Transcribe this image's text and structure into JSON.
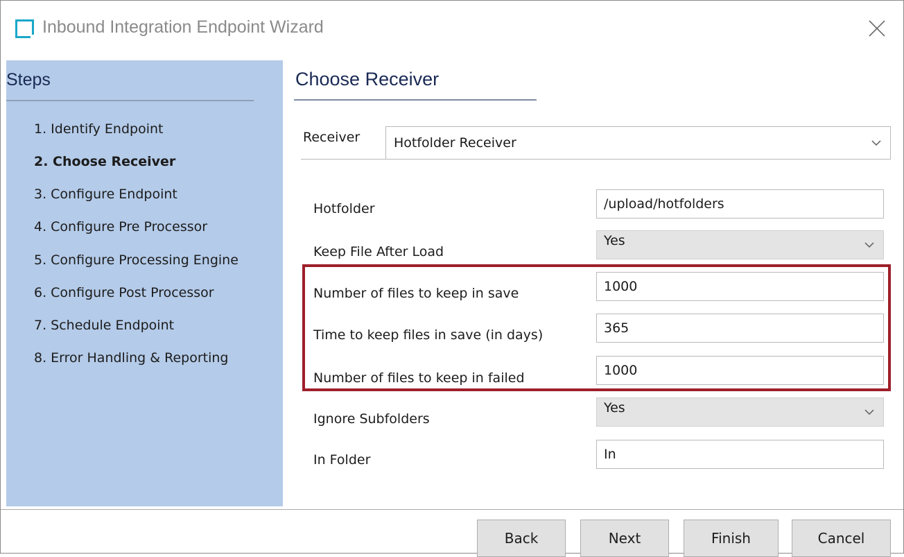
{
  "window": {
    "title": "Inbound Integration Endpoint Wizard"
  },
  "steps": {
    "title": "Steps",
    "items": [
      {
        "label": "1. Identify Endpoint",
        "active": false
      },
      {
        "label": "2. Choose Receiver",
        "active": true
      },
      {
        "label": "3. Configure Endpoint",
        "active": false
      },
      {
        "label": "4. Configure Pre Processor",
        "active": false
      },
      {
        "label": "5. Configure Processing Engine",
        "active": false
      },
      {
        "label": "6. Configure Post Processor",
        "active": false
      },
      {
        "label": "7. Schedule Endpoint",
        "active": false
      },
      {
        "label": "8. Error Handling & Reporting",
        "active": false
      }
    ]
  },
  "main": {
    "title": "Choose Receiver",
    "receiver": {
      "label": "Receiver",
      "value": "Hotfolder Receiver"
    },
    "fields": {
      "hotfolder": {
        "label": "Hotfolder",
        "value": "/upload/hotfolders"
      },
      "keep_file_after_load": {
        "label": "Keep File After Load",
        "value": "Yes"
      },
      "files_keep_save": {
        "label": "Number of files to keep in save",
        "value": "1000"
      },
      "time_keep_save": {
        "label": "Time to keep files in save (in days)",
        "value": "365"
      },
      "files_keep_failed": {
        "label": "Number of files to keep in failed",
        "value": "1000"
      },
      "ignore_subfolders": {
        "label": "Ignore Subfolders",
        "value": "Yes"
      },
      "in_folder": {
        "label": "In Folder",
        "value": "In"
      }
    }
  },
  "footer": {
    "back": "Back",
    "next": "Next",
    "finish": "Finish",
    "cancel": "Cancel"
  },
  "colors": {
    "steps_panel": "#b4cbe9",
    "highlight_border": "#9e1f2a",
    "app_icon": "#1aa7c9"
  },
  "icons": {
    "app": "window-icon",
    "close": "close-icon",
    "dropdown": "chevron-down-icon"
  }
}
